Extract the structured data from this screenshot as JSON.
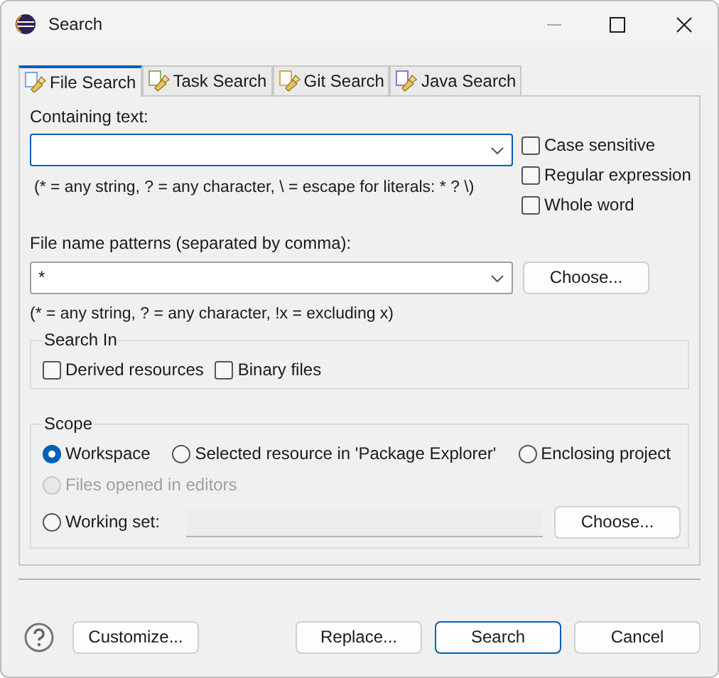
{
  "window": {
    "title": "Search"
  },
  "tabs": [
    {
      "label": "File Search",
      "selected": true
    },
    {
      "label": "Task Search",
      "selected": false
    },
    {
      "label": "Git Search",
      "selected": false
    },
    {
      "label": "Java Search",
      "selected": false
    }
  ],
  "containing_text": {
    "label": "Containing text:",
    "focused": true,
    "hint": "(* = any string, ? = any character, \\ = escape for literals: * ? \\)",
    "options": [
      {
        "label": "Case sensitive",
        "checked": false
      },
      {
        "label": "Regular expression",
        "checked": false
      },
      {
        "label": "Whole word",
        "checked": false
      }
    ]
  },
  "file_name_patterns": {
    "label": "File name patterns (separated by comma):",
    "value": "*",
    "choose_button": "Choose...",
    "hint": "(* = any string, ? = any character, !x = excluding x)"
  },
  "search_in": {
    "title": "Search In",
    "options": [
      {
        "label": "Derived resources",
        "checked": false
      },
      {
        "label": "Binary files",
        "checked": false
      }
    ]
  },
  "scope": {
    "title": "Scope",
    "rows": [
      [
        {
          "label": "Workspace",
          "selected": true,
          "disabled": false
        },
        {
          "label": "Selected resource in 'Package Explorer'",
          "selected": false,
          "disabled": false
        },
        {
          "label": "Enclosing project",
          "selected": false,
          "disabled": false
        }
      ],
      [
        {
          "label": "Files opened in editors",
          "selected": false,
          "disabled": true
        }
      ]
    ],
    "working_set": {
      "label": "Working set:",
      "selected": false,
      "field_disabled": true,
      "choose_button": "Choose..."
    }
  },
  "buttons": [
    {
      "label": "Customize...",
      "default": false
    },
    {
      "label": "Replace...",
      "default": false
    },
    {
      "label": "Search",
      "default": true
    },
    {
      "label": "Cancel",
      "default": false
    }
  ]
}
